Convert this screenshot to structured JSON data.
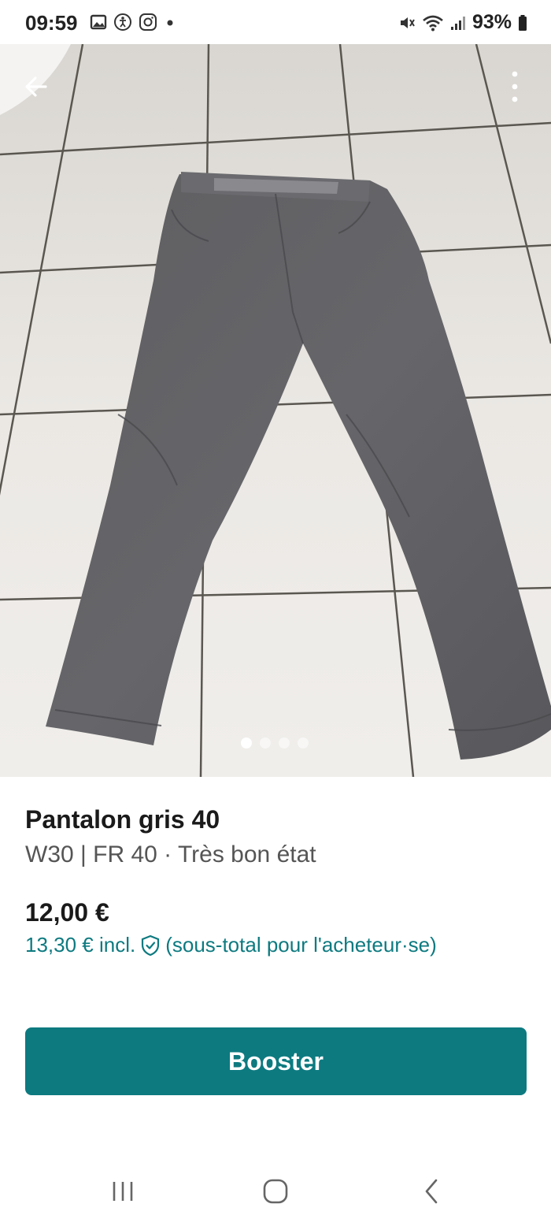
{
  "status_bar": {
    "time": "09:59",
    "battery": "93%"
  },
  "listing": {
    "title": "Pantalon gris 40",
    "details": "W30 | FR 40 · Très bon état",
    "price": "12,00 €",
    "price_incl": "13,30 € incl.",
    "price_incl_note": "(sous-total pour l'acheteur·se)"
  },
  "gallery": {
    "photo_count": 4,
    "active_index": 0
  },
  "actions": {
    "booster_label": "Booster"
  },
  "colors": {
    "accent": "#0d7a80"
  }
}
